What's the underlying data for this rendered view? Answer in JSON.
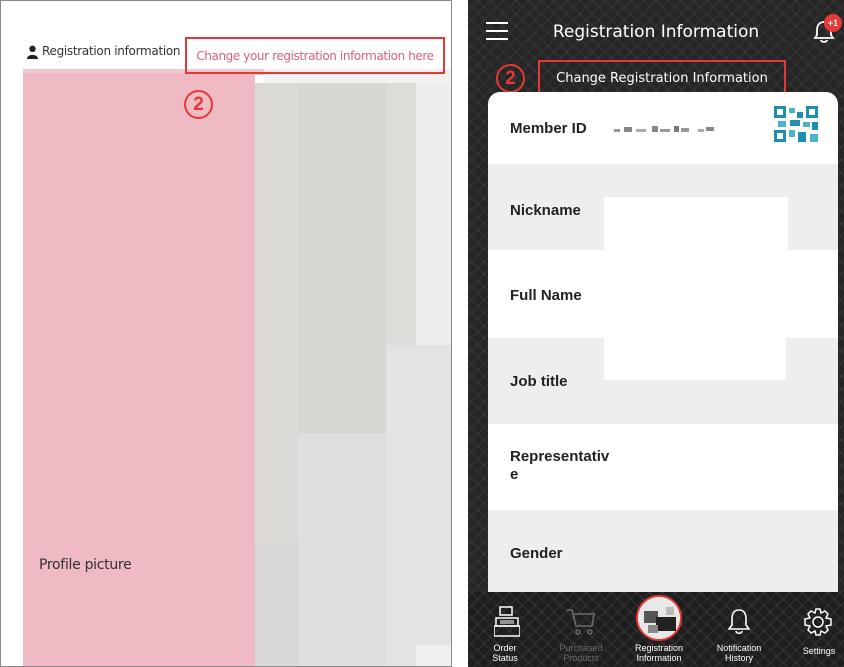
{
  "left": {
    "header_label": "Registration information",
    "change_link": "Change your registration information here",
    "step_marker": "2",
    "profile_picture_label": "Profile picture"
  },
  "right": {
    "title": "Registration Information",
    "notification_badge": "+1",
    "step_marker": "2",
    "change_button": "Change Registration Information",
    "rows": [
      {
        "label": "Member ID"
      },
      {
        "label": "Nickname"
      },
      {
        "label": "Full Name"
      },
      {
        "label": "Job title"
      },
      {
        "label": "Representativ\ne"
      },
      {
        "label": "Gender"
      }
    ],
    "nav": [
      {
        "label": "Order\nStatus",
        "icon": "cash-register-icon"
      },
      {
        "label": "Purchased\nProducts",
        "icon": "cart-icon"
      },
      {
        "label": "Registration\nInformation",
        "icon": "avatar"
      },
      {
        "label": "Notification\nHistory",
        "icon": "bell-icon"
      },
      {
        "label": "Settings",
        "icon": "gear-icon"
      }
    ]
  },
  "colors": {
    "highlight": "#e53935",
    "link_pink": "#d9607a",
    "profile_bg": "#efbac4",
    "dark_bg": "#262626"
  }
}
